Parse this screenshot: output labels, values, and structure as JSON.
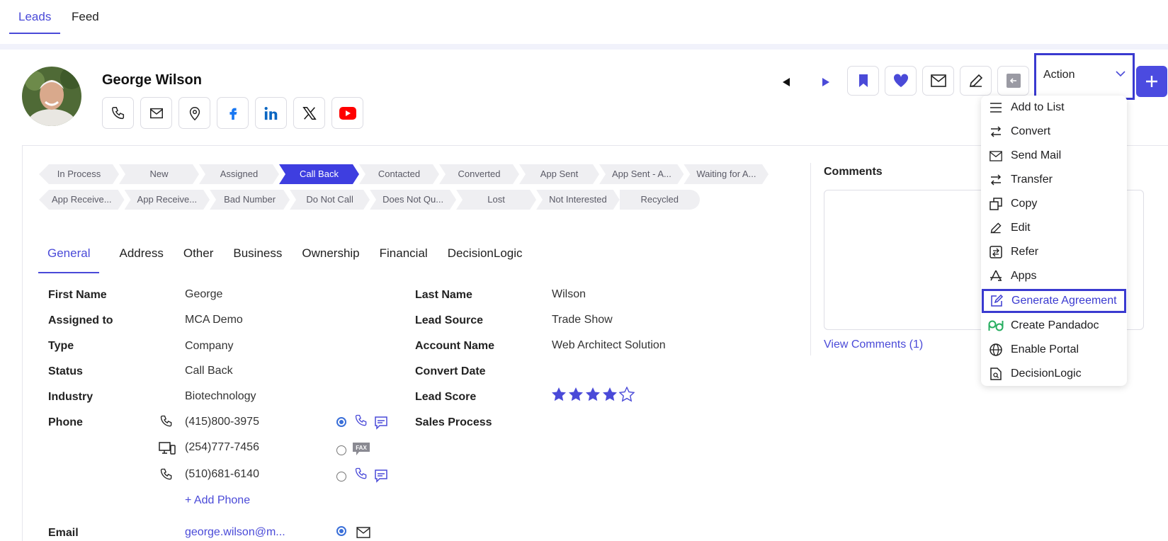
{
  "top_tabs": {
    "leads": "Leads",
    "feed": "Feed"
  },
  "lead": {
    "name": "George Wilson"
  },
  "action": {
    "label": "Action"
  },
  "stages": {
    "row1": [
      "In Process",
      "New",
      "Assigned",
      "Call Back",
      "Contacted",
      "Converted",
      "App Sent",
      "App Sent - A...",
      "Waiting for A..."
    ],
    "row2": [
      "App Receive...",
      "App Receive...",
      "Bad Number",
      "Do Not Call",
      "Does Not Qu...",
      "Lost",
      "Not Interested",
      "Recycled"
    ],
    "active": "Call Back"
  },
  "sub_tabs": [
    "General",
    "Address",
    "Other",
    "Business",
    "Ownership",
    "Financial",
    "DecisionLogic"
  ],
  "fields": {
    "first_name_label": "First Name",
    "first_name": "George",
    "assigned_label": "Assigned to",
    "assigned": "MCA Demo",
    "type_label": "Type",
    "type": "Company",
    "status_label": "Status",
    "status": "Call Back",
    "industry_label": "Industry",
    "industry": "Biotechnology",
    "phone_label": "Phone",
    "phones": [
      "(415)800-3975",
      "(254)777-7456",
      "(510)681-6140"
    ],
    "add_phone": "+ Add Phone",
    "email_label": "Email",
    "email": "george.wilson@m...",
    "last_name_label": "Last Name",
    "last_name": "Wilson",
    "lead_source_label": "Lead Source",
    "lead_source": "Trade Show",
    "account_name_label": "Account Name",
    "account_name": "Web Architect Solution",
    "convert_date_label": "Convert Date",
    "lead_score_label": "Lead Score",
    "lead_score": 4,
    "lead_score_max": 5,
    "sales_process_label": "Sales Process"
  },
  "comments": {
    "title": "Comments",
    "view_link": "View Comments (1)"
  },
  "menu": {
    "items": [
      "Add to List",
      "Convert",
      "Send Mail",
      "Transfer",
      "Copy",
      "Edit",
      "Refer",
      "Apps",
      "Generate Agreement",
      "Create Pandadoc",
      "Enable Portal",
      "DecisionLogic"
    ],
    "highlighted": "Generate Agreement"
  },
  "colors": {
    "accent": "#4a4ad8",
    "active_stage": "#3e3ee0",
    "highlight_border": "#3a3ad0"
  }
}
